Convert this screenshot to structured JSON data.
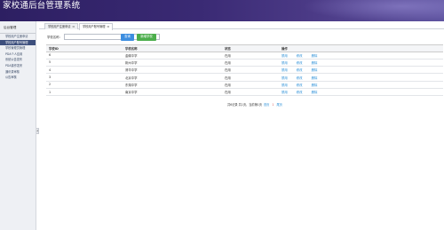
{
  "header": {
    "title": "家校通后台管理系统"
  },
  "sidebar": {
    "heading": "后台管理",
    "items": [
      {
        "label": "学校用户注册申请",
        "active": false
      },
      {
        "label": "学校用户账号管理",
        "active": true
      },
      {
        "label": "学校管理员管理",
        "active": false
      },
      {
        "label": "PDA个人应用",
        "active": false
      },
      {
        "label": "系统公告发布",
        "active": false
      },
      {
        "label": "PDA操作发布",
        "active": false
      },
      {
        "label": "通讯录审核",
        "active": false
      },
      {
        "label": "公告审核",
        "active": false
      }
    ],
    "toggle": "◂"
  },
  "tabs": [
    {
      "label": "学校用户注册申请",
      "close": "⊠",
      "active": false
    },
    {
      "label": "学校用户账号管理",
      "close": "⊠",
      "active": true
    }
  ],
  "search": {
    "label": "学校名称：",
    "value": "",
    "query_label": "查询",
    "add_label": "新增学校"
  },
  "table": {
    "headers": {
      "id": "学校ID",
      "name": "学校名称",
      "status": "状态",
      "ops": "操作"
    },
    "rows": [
      {
        "id": "6",
        "name": "金碟中学",
        "status": "在用",
        "op1": "禁用",
        "op2": "修改",
        "op3": "删除"
      },
      {
        "id": "5",
        "name": "荆州中学",
        "status": "在用",
        "op1": "禁用",
        "op2": "修改",
        "op3": "删除"
      },
      {
        "id": "4",
        "name": "清华中学",
        "status": "在用",
        "op1": "禁用",
        "op2": "修改",
        "op3": "删除"
      },
      {
        "id": "3",
        "name": "北京中学",
        "status": "在用",
        "op1": "禁用",
        "op2": "修改",
        "op3": "删除"
      },
      {
        "id": "2",
        "name": "东湖中学",
        "status": "在用",
        "op1": "禁用",
        "op2": "修改",
        "op3": "删除"
      },
      {
        "id": "1",
        "name": "南京中学",
        "status": "在用",
        "op1": "禁用",
        "op2": "修改",
        "op3": "删除"
      }
    ]
  },
  "pager": {
    "summary": "共6记录 共1页，当前第1页",
    "first": "首页",
    "current": "1",
    "last": "尾页"
  },
  "colors": {
    "header": "#3a2a74",
    "sidebar_active": "#3d4f7d",
    "link": "#2a8fd8",
    "query_btn": "#3d8ee0",
    "add_btn": "#4cae4c"
  }
}
